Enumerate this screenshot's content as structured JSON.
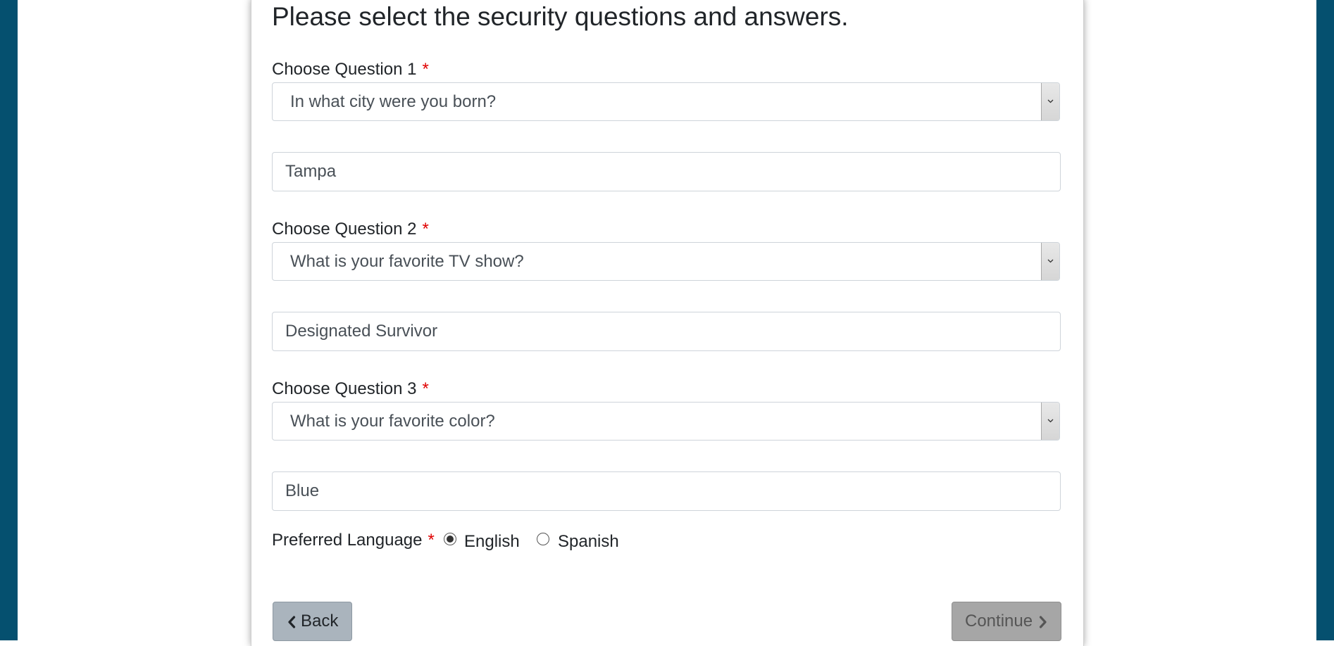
{
  "colors": {
    "side_bar": "#05506f",
    "required_marker": "#e00000",
    "back_button": "#aab4bd",
    "continue_button": "#a6a6a6"
  },
  "form": {
    "heading": "Please select the security questions and answers.",
    "required_marker": "*",
    "questions": [
      {
        "label": "Choose Question 1",
        "selected": "In what city were you born?",
        "answer": "Tampa"
      },
      {
        "label": "Choose Question 2",
        "selected": "What is your favorite TV show?",
        "answer": "Designated Survivor"
      },
      {
        "label": "Choose Question 3",
        "selected": "What is your favorite color?",
        "answer": "Blue"
      }
    ],
    "language": {
      "label": "Preferred Language",
      "options": [
        {
          "label": "English",
          "checked": true
        },
        {
          "label": "Spanish",
          "checked": false
        }
      ]
    },
    "buttons": {
      "back_label": "Back",
      "back_icon": "chevron-left-icon",
      "continue_label": "Continue",
      "continue_icon": "chevron-right-icon"
    }
  }
}
